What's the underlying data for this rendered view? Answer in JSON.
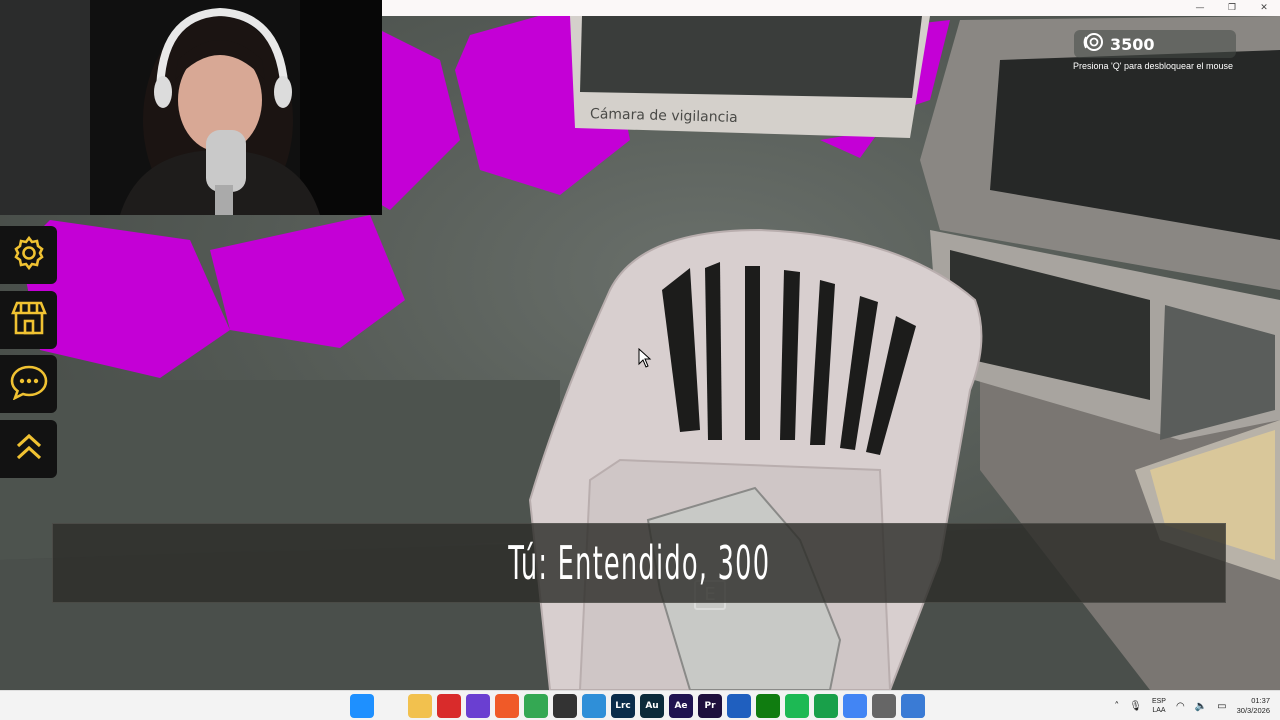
{
  "window": {
    "minimize": "—",
    "maximize": "❐",
    "close": "✕"
  },
  "scene": {
    "monitor_label": "Cámara de vigilancia",
    "key_prompt": "E"
  },
  "hud": {
    "coins_icon": "coin-stack-icon",
    "coins": "3500",
    "hint": "Presiona 'Q' para desbloquear el mouse"
  },
  "side_menu": [
    {
      "name": "settings",
      "icon": "gear-icon"
    },
    {
      "name": "shop",
      "icon": "store-icon"
    },
    {
      "name": "chat",
      "icon": "chat-bubble-icon"
    },
    {
      "name": "expand",
      "icon": "double-chevron-up-icon"
    }
  ],
  "dialogue": {
    "text": "Tú: Entendido, 300"
  },
  "taskbar": {
    "apps": [
      {
        "name": "start",
        "label": "",
        "color": "#1e90ff"
      },
      {
        "name": "search",
        "label": "",
        "color": "#f3f3f3"
      },
      {
        "name": "file-explorer",
        "label": "",
        "color": "#f2c14e"
      },
      {
        "name": "app-red",
        "label": "",
        "color": "#d92b2b"
      },
      {
        "name": "app-purple",
        "label": "",
        "color": "#6a3fd1"
      },
      {
        "name": "brave",
        "label": "",
        "color": "#f05a28"
      },
      {
        "name": "chrome",
        "label": "",
        "color": "#34a853"
      },
      {
        "name": "app-dark",
        "label": "",
        "color": "#333333"
      },
      {
        "name": "notepad",
        "label": "",
        "color": "#2f8fd8"
      },
      {
        "name": "lightroom",
        "label": "Lrc",
        "color": "#0a2c4a"
      },
      {
        "name": "audition",
        "label": "Au",
        "color": "#0b2a3a"
      },
      {
        "name": "after-effects",
        "label": "Ae",
        "color": "#1f1350"
      },
      {
        "name": "premiere",
        "label": "Pr",
        "color": "#1e0f3d"
      },
      {
        "name": "app-blue",
        "label": "",
        "color": "#1f5fbf"
      },
      {
        "name": "xbox",
        "label": "",
        "color": "#107c10"
      },
      {
        "name": "spotify",
        "label": "",
        "color": "#1db954"
      },
      {
        "name": "app-green",
        "label": "",
        "color": "#19a04a"
      },
      {
        "name": "chrome-2",
        "label": "",
        "color": "#4285f4"
      },
      {
        "name": "app-gray",
        "label": "",
        "color": "#666666"
      },
      {
        "name": "active-app",
        "label": "",
        "color": "#3a7bd5"
      }
    ],
    "lang_top": "ESP",
    "lang_bottom": "LAA",
    "time": "01:37",
    "date": "30/3/2026"
  }
}
